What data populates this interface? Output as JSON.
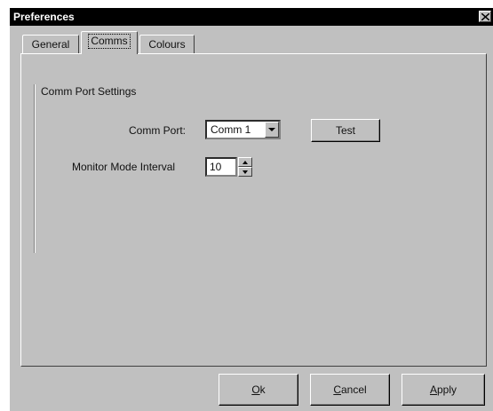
{
  "window": {
    "title": "Preferences"
  },
  "tabs": [
    {
      "label": "General",
      "active": false
    },
    {
      "label": "Comms",
      "active": true
    },
    {
      "label": "Colours",
      "active": false
    }
  ],
  "group": {
    "label": "Comm Port Settings"
  },
  "comm_port": {
    "label": "Comm Port:",
    "value": "Comm 1"
  },
  "test_button": {
    "label": "Test"
  },
  "monitor": {
    "label": "Monitor Mode Interval",
    "value": "10"
  },
  "buttons": {
    "ok": {
      "accel": "O",
      "rest": "k"
    },
    "cancel": {
      "accel": "C",
      "rest": "ancel"
    },
    "apply": {
      "accel": "A",
      "rest": "pply"
    }
  }
}
